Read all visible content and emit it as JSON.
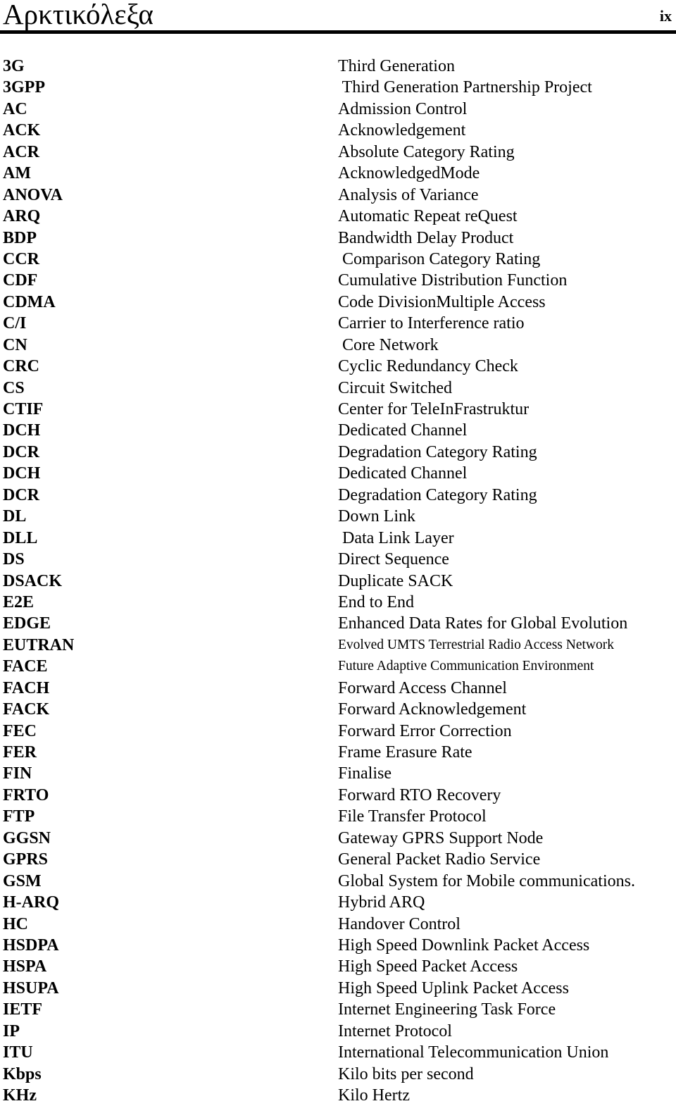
{
  "header": {
    "title": "Αρκτικόλεξα",
    "page_number": "ix"
  },
  "glossary": [
    {
      "abbr": "3G",
      "definition": "Third Generation"
    },
    {
      "abbr": "3GPP",
      "definition": " Third Generation Partnership Project"
    },
    {
      "abbr": "AC",
      "definition": "Admission Control"
    },
    {
      "abbr": "ACK",
      "definition": "Acknowledgement"
    },
    {
      "abbr": "ACR",
      "definition": "Absolute Category Rating"
    },
    {
      "abbr": "AM",
      "definition": "AcknowledgedMode"
    },
    {
      "abbr": "ANOVA",
      "definition": "Analysis of Variance"
    },
    {
      "abbr": "ARQ",
      "definition": "Automatic Repeat reQuest"
    },
    {
      "abbr": "BDP",
      "definition": "Bandwidth Delay Product"
    },
    {
      "abbr": "CCR",
      "definition": " Comparison Category Rating"
    },
    {
      "abbr": "CDF",
      "definition": "Cumulative Distribution Function"
    },
    {
      "abbr": "CDMA",
      "definition": "Code DivisionMultiple Access"
    },
    {
      "abbr": "C/I",
      "definition": "Carrier to Interference ratio"
    },
    {
      "abbr": "CN",
      "definition": " Core Network"
    },
    {
      "abbr": "CRC",
      "definition": "Cyclic Redundancy Check"
    },
    {
      "abbr": "CS",
      "definition": "Circuit Switched"
    },
    {
      "abbr": "CTIF",
      "definition": "Center for TeleInFrastruktur"
    },
    {
      "abbr": "DCH",
      "definition": "Dedicated Channel"
    },
    {
      "abbr": "DCR",
      "definition": "Degradation Category Rating"
    },
    {
      "abbr": "DCH",
      "definition": "Dedicated Channel"
    },
    {
      "abbr": "DCR",
      "definition": "Degradation Category Rating"
    },
    {
      "abbr": "DL",
      "definition": "Down Link"
    },
    {
      "abbr": "DLL",
      "definition": " Data Link Layer"
    },
    {
      "abbr": "DS",
      "definition": "Direct Sequence"
    },
    {
      "abbr": "DSACK",
      "definition": "Duplicate SACK"
    },
    {
      "abbr": "E2E",
      "definition": "End to End"
    },
    {
      "abbr": "EDGE",
      "definition": "Enhanced Data Rates for Global Evolution"
    },
    {
      "abbr": "EUTRAN",
      "definition": "Evolved UMTS Terrestrial Radio Access Network",
      "small": true
    },
    {
      "abbr": "FACE",
      "definition": "Future Adaptive Communication Environment",
      "small": true
    },
    {
      "abbr": "FACH",
      "definition": "Forward Access Channel"
    },
    {
      "abbr": "FACK",
      "definition": "Forward Acknowledgement"
    },
    {
      "abbr": "FEC",
      "definition": "Forward Error Correction"
    },
    {
      "abbr": "FER",
      "definition": "Frame Erasure Rate"
    },
    {
      "abbr": "FIN",
      "definition": "Finalise"
    },
    {
      "abbr": "FRTO",
      "definition": "Forward RTO Recovery"
    },
    {
      "abbr": "FTP",
      "definition": "File Transfer Protocol"
    },
    {
      "abbr": "GGSN",
      "definition": "Gateway GPRS Support Node"
    },
    {
      "abbr": "GPRS",
      "definition": "General Packet Radio Service"
    },
    {
      "abbr": "GSM",
      "definition": "Global System for Mobile communications."
    },
    {
      "abbr": "H-ARQ",
      "definition": "Hybrid ARQ"
    },
    {
      "abbr": "HC",
      "definition": "Handover Control"
    },
    {
      "abbr": "HSDPA",
      "definition": "High Speed Downlink Packet Access"
    },
    {
      "abbr": "HSPA",
      "definition": "High Speed Packet Access"
    },
    {
      "abbr": "HSUPA",
      "definition": "High Speed Uplink Packet Access"
    },
    {
      "abbr": "IETF",
      "definition": "Internet Engineering Task Force"
    },
    {
      "abbr": "IP",
      "definition": "Internet Protocol"
    },
    {
      "abbr": "ITU",
      "definition": "International Telecommunication Union"
    },
    {
      "abbr": "Kbps",
      "definition": "Kilo bits per second"
    },
    {
      "abbr": "KHz",
      "definition": "Kilo Hertz"
    }
  ]
}
